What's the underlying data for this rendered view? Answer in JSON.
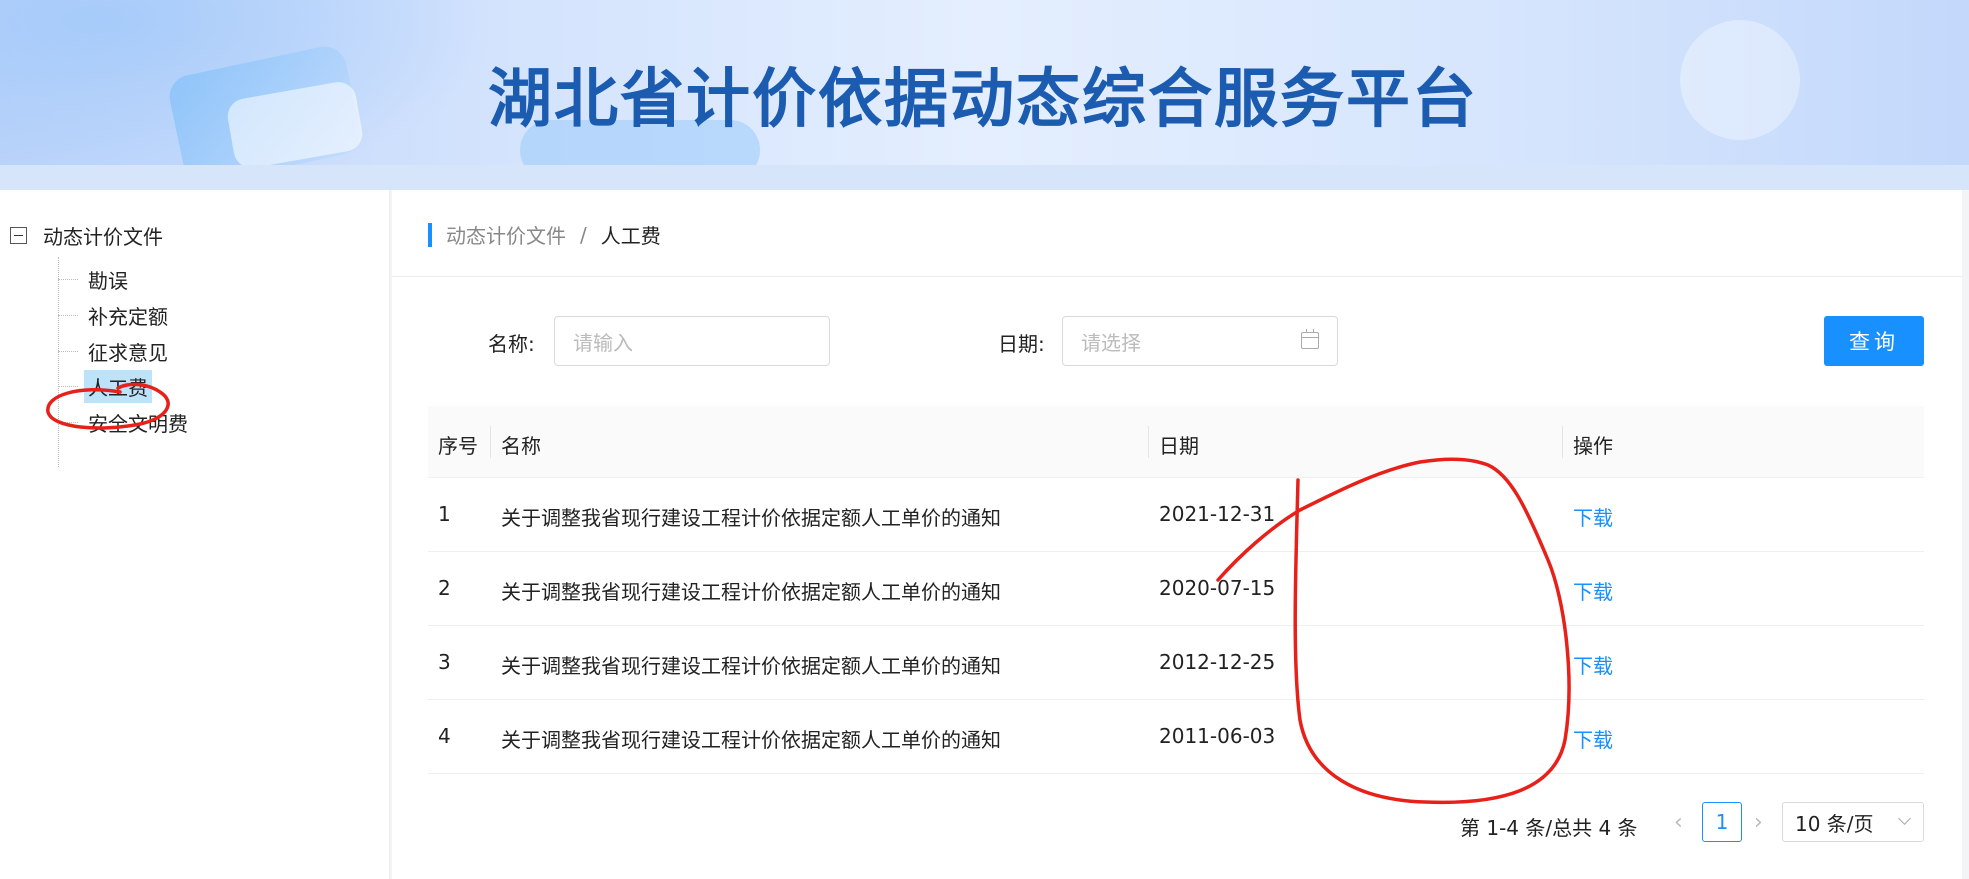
{
  "banner": {
    "title": "湖北省计价依据动态综合服务平台"
  },
  "sidebar": {
    "root_label": "动态计价文件",
    "items": [
      {
        "label": "勘误"
      },
      {
        "label": "补充定额"
      },
      {
        "label": "征求意见"
      },
      {
        "label": "人工费",
        "active": true
      },
      {
        "label": "安全文明费"
      }
    ]
  },
  "breadcrumb": {
    "parent": "动态计价文件",
    "separator": "/",
    "current": "人工费"
  },
  "filters": {
    "name_label": "名称:",
    "name_placeholder": "请输入",
    "date_label": "日期:",
    "date_placeholder": "请选择",
    "query_button": "查询"
  },
  "table": {
    "columns": [
      "序号",
      "名称",
      "日期",
      "操作"
    ],
    "rows": [
      {
        "index": "1",
        "name": "关于调整我省现行建设工程计价依据定额人工单价的通知",
        "date": "2021-12-31",
        "action": "下载"
      },
      {
        "index": "2",
        "name": "关于调整我省现行建设工程计价依据定额人工单价的通知",
        "date": "2020-07-15",
        "action": "下载"
      },
      {
        "index": "3",
        "name": "关于调整我省现行建设工程计价依据定额人工单价的通知",
        "date": "2012-12-25",
        "action": "下载"
      },
      {
        "index": "4",
        "name": "关于调整我省现行建设工程计价依据定额人工单价的通知",
        "date": "2011-06-03",
        "action": "下载"
      }
    ]
  },
  "pagination": {
    "total_text": "第 1-4 条/总共 4 条",
    "current_page": "1",
    "page_size": "10 条/页"
  },
  "colors": {
    "accent": "#1890ff",
    "title": "#1b5bb0",
    "annotation": "#e8201a"
  }
}
